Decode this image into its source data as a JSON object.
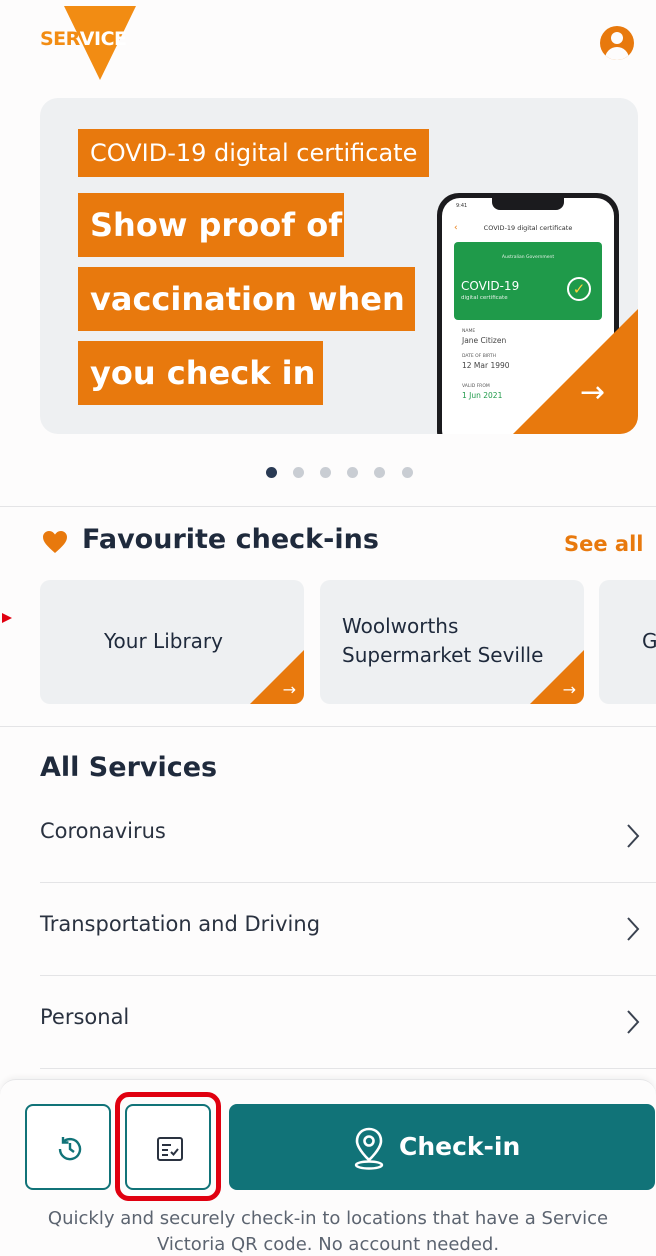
{
  "header": {
    "logo_text_a": "SER",
    "logo_text_b": "V",
    "logo_text_c": "ICE",
    "profile_icon": "profile-icon"
  },
  "banner": {
    "tag_line": "COVID-19 digital certificate",
    "headline_1": "Show proof of",
    "headline_2": "vaccination when",
    "headline_3": "you check in",
    "arrow_icon": "arrow-right-icon",
    "phone": {
      "time": "9:41",
      "title": "COVID-19 digital certificate",
      "card_gov": "Australian Government",
      "card_title": "COVID-19",
      "card_sub": "digital certificate",
      "name_label": "NAME",
      "name_value": "Jane Citizen",
      "dob_label": "DATE OF BIRTH",
      "dob_value": "12 Mar 1990",
      "valid_label": "VALID FROM",
      "valid_value": "1 Jun 2021"
    },
    "pages": 6,
    "active_page": 1
  },
  "favourites": {
    "title": "Favourite check-ins",
    "see_all": "See all",
    "heart_icon": "heart-icon",
    "cards": [
      {
        "line1": "Your Library",
        "line2": ""
      },
      {
        "line1": "Woolworths",
        "line2": "Supermarket Seville"
      },
      {
        "line1": "G",
        "line2": ""
      }
    ]
  },
  "services": {
    "title": "All Services",
    "items": [
      {
        "label": "Coronavirus"
      },
      {
        "label": "Transportation and Driving"
      },
      {
        "label": "Personal"
      }
    ]
  },
  "bottom": {
    "history_icon": "history-icon",
    "checklist_icon": "checklist-icon",
    "checkin_label": "Check-in",
    "checkin_icon": "location-pin-icon",
    "footer": "Quickly and securely check-in to locations that have a Service Victoria QR code. No account needed."
  },
  "colors": {
    "accent": "#e8790d",
    "teal": "#117378",
    "highlight": "#e00010"
  }
}
